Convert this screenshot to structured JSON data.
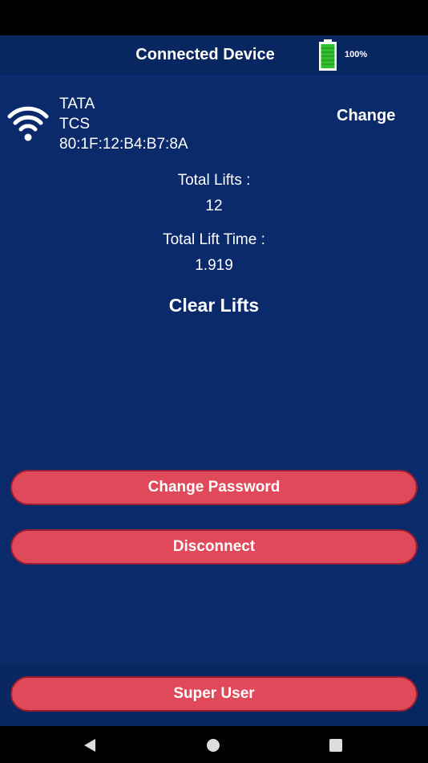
{
  "header": {
    "title": "Connected Device",
    "battery_text": "100%"
  },
  "device": {
    "name": "TATA",
    "network": "TCS",
    "mac": "80:1F:12:B4:B7:8A",
    "change_label": "Change"
  },
  "stats": {
    "total_lifts_label": "Total Lifts :",
    "total_lifts_value": "12",
    "total_lift_time_label": "Total Lift Time :",
    "total_lift_time_value": "1.919"
  },
  "actions": {
    "clear_lifts_label": "Clear Lifts",
    "change_password_label": "Change Password",
    "disconnect_label": "Disconnect",
    "super_user_label": "Super User"
  },
  "icons": {
    "wifi": "wifi-icon",
    "battery": "battery-icon",
    "back": "back-triangle-icon",
    "home": "home-circle-icon",
    "recents": "recents-square-icon"
  },
  "colors": {
    "background": "#0a2a6b",
    "header": "#082660",
    "button": "#e0495a",
    "battery_fill": "#2fbf2f"
  }
}
